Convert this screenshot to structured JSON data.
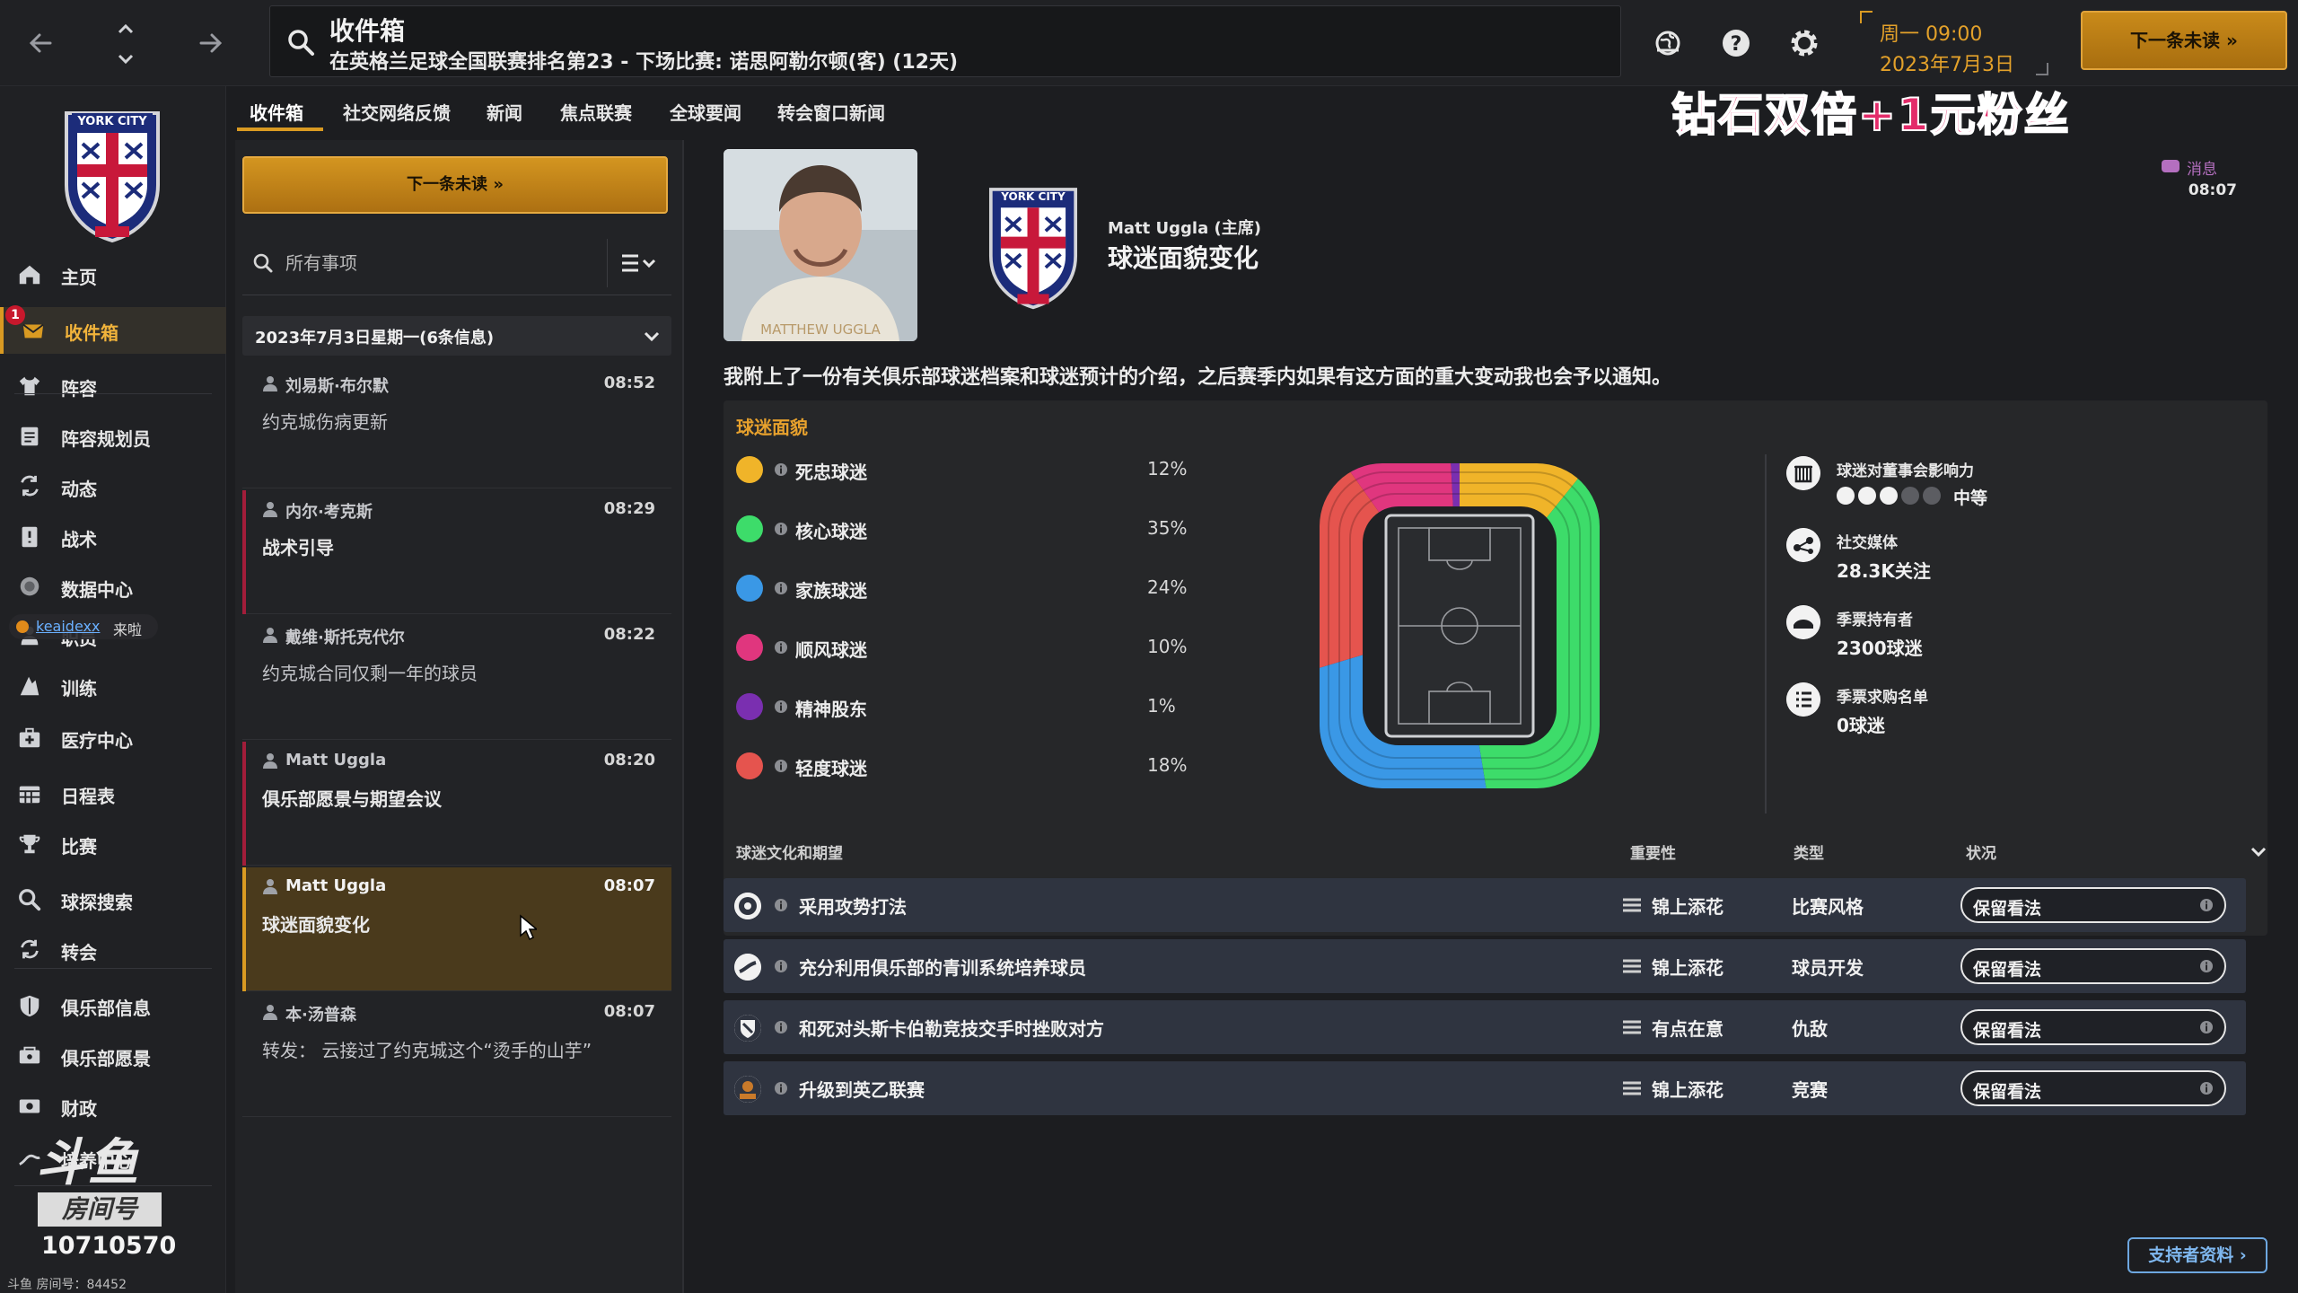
{
  "topbar": {
    "title": "收件箱",
    "subtitle": "在英格兰足球全国联赛排名第23 - 下场比赛: 诺思阿勒尔顿(客) (12天)",
    "date_day": "周一 09:00",
    "date_full": "2023年7月3日",
    "continue_label": "下一条未读  »"
  },
  "promo": "钻石双倍+1元粉丝",
  "tabs": [
    "收件箱",
    "社交网络反馈",
    "新闻",
    "焦点联赛",
    "全球要闻",
    "转会窗口新闻"
  ],
  "sidebar": {
    "inbox_badge": "1",
    "items": [
      {
        "label": "主页",
        "icon": "home-icon"
      },
      {
        "label": "收件箱",
        "icon": "inbox-icon"
      },
      {
        "label": "阵容",
        "icon": "shirt-icon"
      },
      {
        "label": "阵容规划员",
        "icon": "clipboard-icon"
      },
      {
        "label": "动态",
        "icon": "dynamics-icon"
      },
      {
        "label": "战术",
        "icon": "tactics-icon"
      },
      {
        "label": "数据中心",
        "icon": "data-hub-icon"
      },
      {
        "label": "职员",
        "icon": "staff-icon"
      },
      {
        "label": "训练",
        "icon": "training-icon"
      },
      {
        "label": "医疗中心",
        "icon": "medical-icon"
      },
      {
        "label": "日程表",
        "icon": "calendar-icon"
      },
      {
        "label": "比赛",
        "icon": "trophy-icon"
      },
      {
        "label": "球探搜索",
        "icon": "scouting-icon"
      },
      {
        "label": "转会",
        "icon": "transfer-icon"
      },
      {
        "label": "俱乐部信息",
        "icon": "shield-icon"
      },
      {
        "label": "俱乐部愿景",
        "icon": "vision-icon"
      },
      {
        "label": "财政",
        "icon": "finance-icon"
      },
      {
        "label": "培养中心",
        "icon": "development-icon"
      }
    ],
    "fan_name": "keaidexx",
    "fan_suffix": "来啦"
  },
  "crest_text": "YORK CITY",
  "watermark": {
    "logo": "斗鱼",
    "room_tag": "房间号",
    "room_number": "10710570",
    "bottom": "斗鱼 房间号：84452"
  },
  "list": {
    "continue_label": "下一条未读  »",
    "search_placeholder": "所有事项",
    "group_label": "2023年7月3日星期一(6条信息)",
    "messages": [
      {
        "sender": "刘易斯·布尔默",
        "time": "08:52",
        "subject": "约克城伤病更新"
      },
      {
        "sender": "内尔·考克斯",
        "time": "08:29",
        "subject": "战术引导"
      },
      {
        "sender": "戴维·斯托克代尔",
        "time": "08:22",
        "subject": "约克城合同仅剩一年的球员"
      },
      {
        "sender": "Matt Uggla",
        "time": "08:20",
        "subject": "俱乐部愿景与期望会议"
      },
      {
        "sender": "Matt Uggla",
        "time": "08:07",
        "subject": "球迷面貌变化"
      },
      {
        "sender": "本·汤普森",
        "time": "08:07",
        "subject": "转发： 云接过了约克城这个“烫手的山芋”"
      }
    ]
  },
  "message": {
    "photo_caption": "MATTHEW UGGLA",
    "sender": "Matt Uggla (主席)",
    "title": "球迷面貌变化",
    "tag": "消息",
    "time": "08:07",
    "intro": "我附上了一份有关俱乐部球迷档案和球迷预计的介绍，之后赛季内如果有这方面的重大变动我也会予以通知。"
  },
  "fan_profile": {
    "title": "球迷面貌",
    "segments": [
      {
        "name": "死忠球迷",
        "pct": 12,
        "label": "12%",
        "color": "#f0b429"
      },
      {
        "name": "核心球迷",
        "pct": 35,
        "label": "35%",
        "color": "#3ddc6a"
      },
      {
        "name": "家族球迷",
        "pct": 24,
        "label": "24%",
        "color": "#3a98e6"
      },
      {
        "name": "顺风球迷",
        "pct": 10,
        "label": "10%",
        "color": "#e0367e"
      },
      {
        "name": "精神股东",
        "pct": 1,
        "label": "1%",
        "color": "#7a2fb0"
      },
      {
        "name": "轻度球迷",
        "pct": 18,
        "label": "18%",
        "color": "#e5544e"
      }
    ]
  },
  "stats": {
    "influence_label": "球迷对董事会影响力",
    "influence_level": "中等",
    "influence_score": 3,
    "influence_max": 5,
    "social_label": "社交媒体",
    "social_value": "28.3K关注",
    "season_ticket_label": "季票持有者",
    "season_ticket_value": "2300球迷",
    "waitlist_label": "季票求购名单",
    "waitlist_value": "0球迷"
  },
  "culture": {
    "title": "球迷文化和期望",
    "col_importance": "重要性",
    "col_type": "类型",
    "col_status": "状况",
    "rows": [
      {
        "text": "采用攻势打法",
        "importance": "锦上添花",
        "type": "比赛风格",
        "status": "保留看法",
        "icon": "football-icon"
      },
      {
        "text": "充分利用俱乐部的青训系统培养球员",
        "importance": "锦上添花",
        "type": "球员开发",
        "status": "保留看法",
        "icon": "youth-icon"
      },
      {
        "text": "和死对头斯卡伯勒竞技交手时挫败对方",
        "importance": "有点在意",
        "type": "仇敌",
        "status": "保留看法",
        "icon": "rival-crest-icon"
      },
      {
        "text": "升级到英乙联赛",
        "importance": "锦上添花",
        "type": "竞赛",
        "status": "保留看法",
        "icon": "promotion-icon"
      }
    ]
  },
  "supporter_button": "支持者资料 ›"
}
